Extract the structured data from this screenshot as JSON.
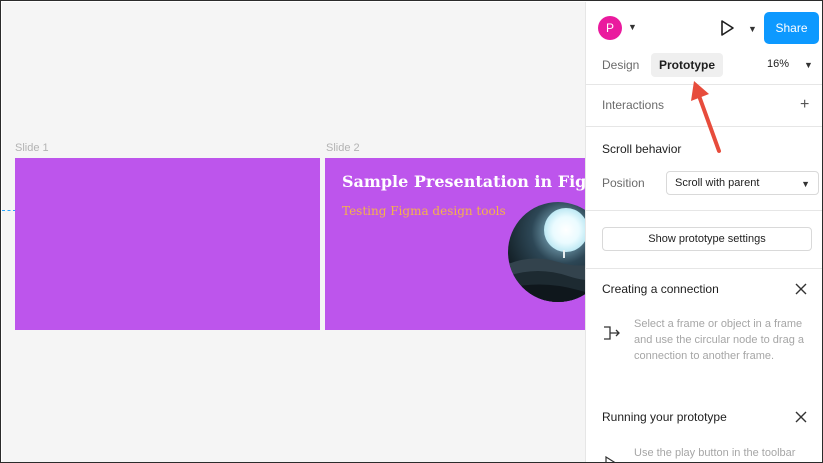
{
  "canvas": {
    "slides": [
      {
        "label": "Slide 1"
      },
      {
        "label": "Slide 2",
        "title": "Sample Presentation in Figma",
        "subtitle": "Testing Figma design tools"
      }
    ]
  },
  "header": {
    "avatar_initial": "P",
    "share_label": "Share",
    "tabs": [
      "Design",
      "Prototype"
    ],
    "active_tab": "Prototype",
    "zoom": "16%"
  },
  "interactions": {
    "title": "Interactions"
  },
  "scroll": {
    "title": "Scroll behavior",
    "position_label": "Position",
    "position_value": "Scroll with parent"
  },
  "settings_button": "Show prototype settings",
  "help": {
    "connection_title": "Creating a connection",
    "connection_text": "Select a frame or object in a frame and use the circular node to drag a connection to another frame.",
    "running_title": "Running your prototype",
    "running_text": "Use the play button in the toolbar"
  },
  "colors": {
    "slide_bg": "#bd55ec",
    "accent": "#0d99ff",
    "avatar": "#ea1a9e",
    "annotation_arrow": "#e74c3c"
  },
  "icons": [
    "play-icon",
    "chevron-down-icon",
    "plus-icon",
    "close-icon",
    "connection-icon",
    "arrow-annotation"
  ]
}
